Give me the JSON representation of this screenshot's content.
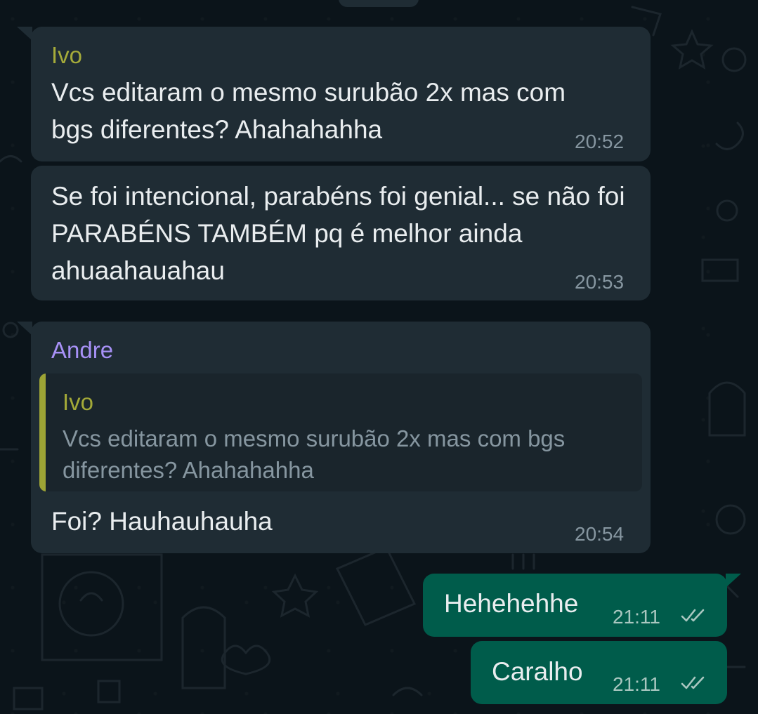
{
  "colors": {
    "background": "#0b141a",
    "incoming_bubble": "#1f2c34",
    "outgoing_bubble": "#005c4b",
    "sender_ivo": "#a5ab3a",
    "sender_andre": "#a791f6",
    "timestamp": "#8696a0",
    "read_ticks": "#a9c7c0"
  },
  "messages": [
    {
      "sender": "Ivo",
      "text": "Vcs editaram o mesmo surubão 2x mas com bgs diferentes? Ahahahahha",
      "time": "20:52"
    },
    {
      "text": "Se foi intencional, parabéns foi genial... se não foi PARABÉNS TAMBÉM pq é melhor ainda ahuaahauahau",
      "time": "20:53"
    },
    {
      "sender": "Andre",
      "reply": {
        "sender": "Ivo",
        "text": "Vcs editaram o mesmo surubão 2x mas com bgs diferentes? Ahahahahha"
      },
      "text": "Foi? Hauhauhauha",
      "time": "20:54"
    },
    {
      "text": "Hehehehhe",
      "time": "21:11",
      "status_icon": "double-check-icon"
    },
    {
      "text": "Caralho",
      "time": "21:11",
      "status_icon": "double-check-icon"
    }
  ]
}
